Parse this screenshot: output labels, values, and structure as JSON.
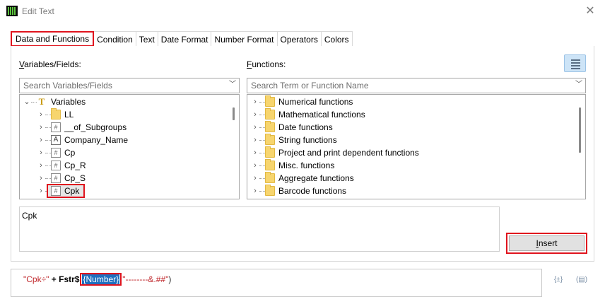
{
  "window": {
    "title": "Edit Text"
  },
  "tabs": [
    {
      "label": "Data and Functions",
      "active": true
    },
    {
      "label": "Condition"
    },
    {
      "label": "Text"
    },
    {
      "label": "Date Format"
    },
    {
      "label": "Number Format"
    },
    {
      "label": "Operators"
    },
    {
      "label": "Colors"
    }
  ],
  "variables": {
    "label_underlined": "V",
    "label_rest": "ariables/Fields:",
    "search_placeholder": "Search Variables/Fields",
    "items": [
      {
        "label": "Variables",
        "icon": "t-variable-icon",
        "expanded": true
      },
      {
        "label": "LL",
        "icon": "folder-icon"
      },
      {
        "label": "__of_Subgroups",
        "icon": "numeric-field-icon"
      },
      {
        "label": "Company_Name",
        "icon": "text-field-icon"
      },
      {
        "label": "Cp",
        "icon": "numeric-field-icon"
      },
      {
        "label": "Cp_R",
        "icon": "numeric-field-icon"
      },
      {
        "label": "Cp_S",
        "icon": "numeric-field-icon"
      },
      {
        "label": "Cpk",
        "icon": "numeric-field-icon",
        "selected": true
      }
    ]
  },
  "functions": {
    "label_underlined": "F",
    "label_rest": "unctions:",
    "search_placeholder": "Search Term or Function Name",
    "items": [
      {
        "label": "Numerical functions"
      },
      {
        "label": "Mathematical functions"
      },
      {
        "label": "Date functions"
      },
      {
        "label": "String functions"
      },
      {
        "label": "Project and print dependent functions"
      },
      {
        "label": "Misc. functions"
      },
      {
        "label": "Aggregate functions"
      },
      {
        "label": "Barcode functions"
      }
    ]
  },
  "preview": {
    "text": "Cpk"
  },
  "insert_button": {
    "underlined": "I",
    "rest": "nsert"
  },
  "formula": {
    "part1": "\"Cpk÷\"",
    "part2": " + ",
    "part3": "Fstr$",
    "part4": "(",
    "selected": "{Number}",
    "part5": "\"",
    "part6": "--------&.##\"",
    "part7": ")"
  },
  "colors": {
    "highlight": "#e0141e",
    "selection": "#1f6fbf",
    "string": "#c0282c"
  }
}
